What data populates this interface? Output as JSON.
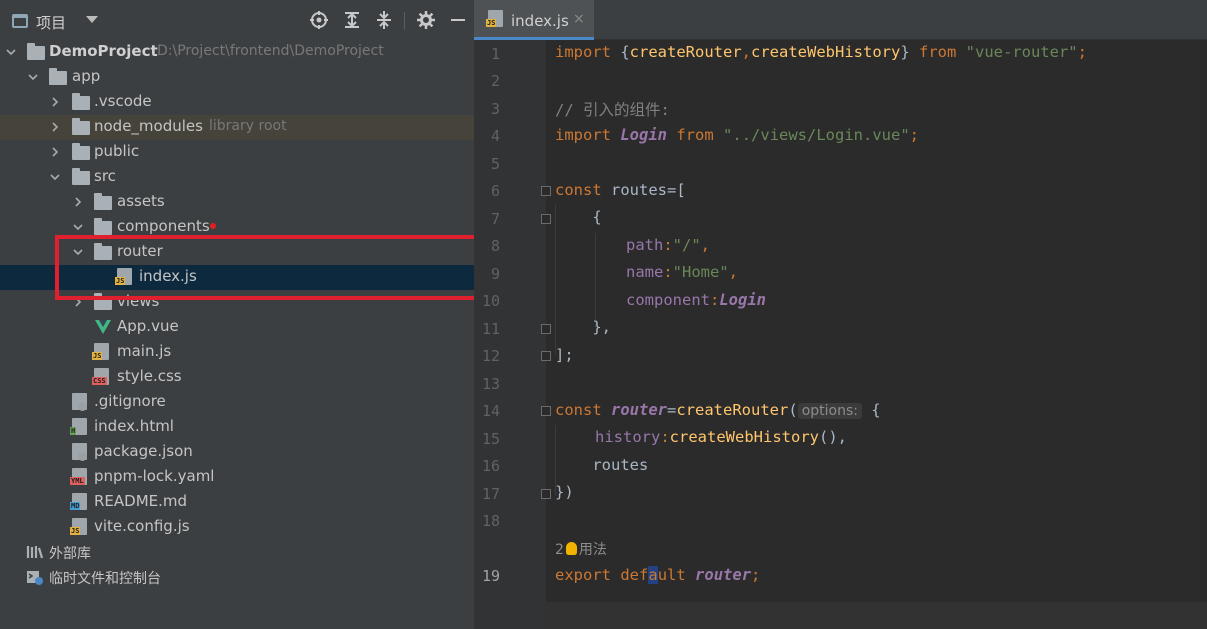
{
  "project_panel": {
    "title": "项目",
    "tree": [
      {
        "label": "DemoProject",
        "path": "D:\\Project\\frontend\\DemoProject"
      },
      {
        "label": "app"
      },
      {
        "label": ".vscode"
      },
      {
        "label": "node_modules",
        "note": "library root"
      },
      {
        "label": "public"
      },
      {
        "label": "src"
      },
      {
        "label": "assets"
      },
      {
        "label": "components"
      },
      {
        "label": "router"
      },
      {
        "label": "index.js"
      },
      {
        "label": "views"
      },
      {
        "label": "App.vue"
      },
      {
        "label": "main.js"
      },
      {
        "label": "style.css"
      },
      {
        "label": ".gitignore"
      },
      {
        "label": "index.html"
      },
      {
        "label": "package.json"
      },
      {
        "label": "pnpm-lock.yaml"
      },
      {
        "label": "README.md"
      },
      {
        "label": "vite.config.js"
      },
      {
        "label": "外部库"
      },
      {
        "label": "临时文件和控制台"
      }
    ],
    "badges": {
      "js": "JS",
      "css": "CSS",
      "html": "H",
      "yml": "YML",
      "md": "MD"
    }
  },
  "editor": {
    "tab": {
      "name": "index.js",
      "close": "×"
    },
    "line_numbers": [
      "1",
      "2",
      "3",
      "4",
      "5",
      "6",
      "7",
      "8",
      "9",
      "10",
      "11",
      "12",
      "13",
      "14",
      "15",
      "16",
      "17",
      "18",
      "19"
    ],
    "code": {
      "l1": {
        "kw": "import",
        "p1": " {",
        "fn1": "createRouter",
        "p2": ",",
        "fn2": "createWebHistory",
        "p3": "} ",
        "kw2": "from",
        "sp": " ",
        "str": "\"vue-router\"",
        "end": ";"
      },
      "l3": "// 引入的组件:",
      "l4": {
        "kw": "import",
        "sp": " ",
        "id": "Login",
        "sp2": " ",
        "kw2": "from",
        "sp3": " ",
        "str": "\"../views/Login.vue\"",
        "end": ";"
      },
      "l6": {
        "kw": "const",
        "rest": " routes=["
      },
      "l7": "    {",
      "l8": {
        "prop": "path",
        "colon": ":",
        "str": "\"/\"",
        "end": ","
      },
      "l9": {
        "prop": "name",
        "colon": ":",
        "str": "\"Home\"",
        "end": ","
      },
      "l10": {
        "prop": "component",
        "colon": ":",
        "id": "Login"
      },
      "l11": "    },",
      "l12": "];",
      "l14": {
        "kw": "const",
        "sp": " ",
        "id": "router",
        "eq": "=",
        "fn": "createRouter",
        "open": "(",
        "hint": "options:",
        "brace": " {"
      },
      "l15": {
        "prop": "history",
        "colon": ":",
        "fn": "createWebHistory",
        "end": "(),"
      },
      "l16": "    routes",
      "l17": "})",
      "usage_count": "2",
      "usage_label": "用法",
      "l19": {
        "kw": "export",
        "sp": " ",
        "kw2a": "def",
        "caret": "a",
        "kw2b": "ult",
        "sp2": " ",
        "id": "router",
        "end": ";"
      }
    }
  },
  "colors": {
    "panel_bg": "#3c3f41",
    "editor_bg": "#2b2b2b",
    "selection": "#0d293e",
    "highlight_box": "#e0202e",
    "keyword": "#cc7832",
    "string": "#6a8759",
    "property": "#9876aa",
    "function": "#ffc66d"
  }
}
